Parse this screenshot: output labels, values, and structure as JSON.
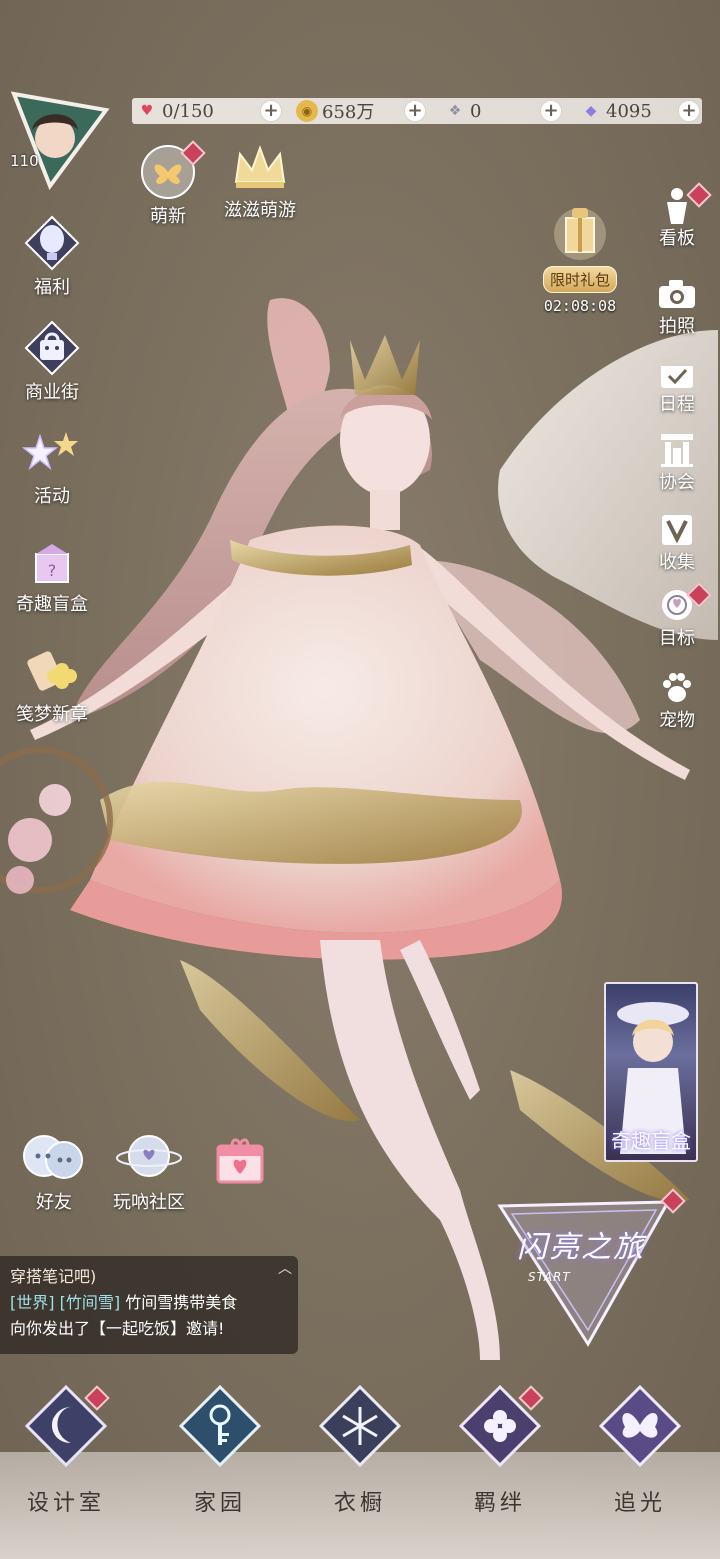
{
  "resources": {
    "stamina": "0/150",
    "coins": "658万",
    "crystals": "0",
    "diamonds": "4095"
  },
  "player": {
    "level": "110"
  },
  "top_events": {
    "newbie": "萌新",
    "trip": "滋滋萌游"
  },
  "left_menu": [
    {
      "label": "福利",
      "icon": "hot-air-balloon-icon"
    },
    {
      "label": "商业街",
      "icon": "shopping-bag-icon"
    },
    {
      "label": "活动",
      "icon": "stars-icon"
    },
    {
      "label": "奇趣盲盒",
      "icon": "gift-box-icon"
    },
    {
      "label": "笺梦新章",
      "icon": "scroll-clover-icon"
    }
  ],
  "right_menu": [
    {
      "label": "看板",
      "icon": "mannequin-icon"
    },
    {
      "label": "拍照",
      "icon": "camera-icon"
    },
    {
      "label": "日程",
      "icon": "calendar-check-icon"
    },
    {
      "label": "协会",
      "icon": "building-icon"
    },
    {
      "label": "收集",
      "icon": "v-badge-icon"
    },
    {
      "label": "目标",
      "icon": "target-medal-icon"
    },
    {
      "label": "宠物",
      "icon": "paw-icon"
    }
  ],
  "gift_pack": {
    "label": "限时礼包",
    "timer": "02:08:08"
  },
  "social": [
    {
      "label": "好友",
      "icon": "friends-icon"
    },
    {
      "label": "玩吶社区",
      "icon": "planet-heart-icon"
    },
    {
      "label": "",
      "icon": "gift-heart-icon"
    }
  ],
  "chat": {
    "line1": "穿搭笔记吧)",
    "channel": "[世界]",
    "sender": "[竹间雪]",
    "message": "竹间雪携带美食",
    "message2": "向你发出了【一起吃饭】邀请!"
  },
  "promo_card": {
    "title": "奇趣盲盒"
  },
  "start_banner": {
    "title": "闪亮之旅",
    "sub": "START"
  },
  "bottom_nav": [
    {
      "label": "设计室",
      "icon": "moon-icon"
    },
    {
      "label": "家园",
      "icon": "key-icon"
    },
    {
      "label": "衣橱",
      "icon": "snowflake-icon"
    },
    {
      "label": "羁绊",
      "icon": "clover-icon"
    },
    {
      "label": "追光",
      "icon": "butterfly-icon"
    }
  ],
  "colors": {
    "background": "#7c705f",
    "accent_pink": "#c9415a",
    "nav_text": "#3c3530"
  }
}
